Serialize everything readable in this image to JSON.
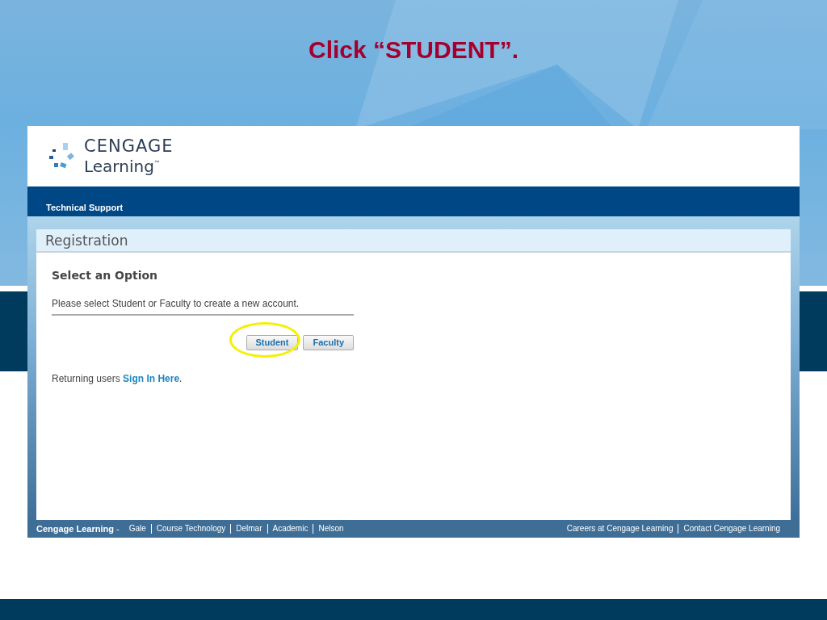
{
  "slide": {
    "title": "Click “STUDENT”."
  },
  "site": {
    "logo": {
      "line_1": "CENGAGE",
      "line_2": "Learning$^{™}$"
    },
    "nav": [
      "Technical Support"
    ],
    "panel": {
      "title": "Registration",
      "heading": "Select an Option",
      "instruction": "Please select Student or Faculty to create a new account.",
      "buttons": [
        {
          "label": "Student",
          "highlighted": true
        },
        {
          "label": "Faculty",
          "highlighted": false
        }
      ],
      "returning": {
        "text": "Returning users",
        "link": "Sign In Here",
        "end": "."
      }
    },
    "footer": {
      "brand": "**Cengage Learning** -",
      "left_links": [
        "Gale",
        "Course Technology",
        "Delmar",
        "Academic",
        "Nelson"
      ],
      "right_links": [
        "Careers at Cengage Learning",
        "Contact Cengage Learning"
      ]
    }
  }
}
